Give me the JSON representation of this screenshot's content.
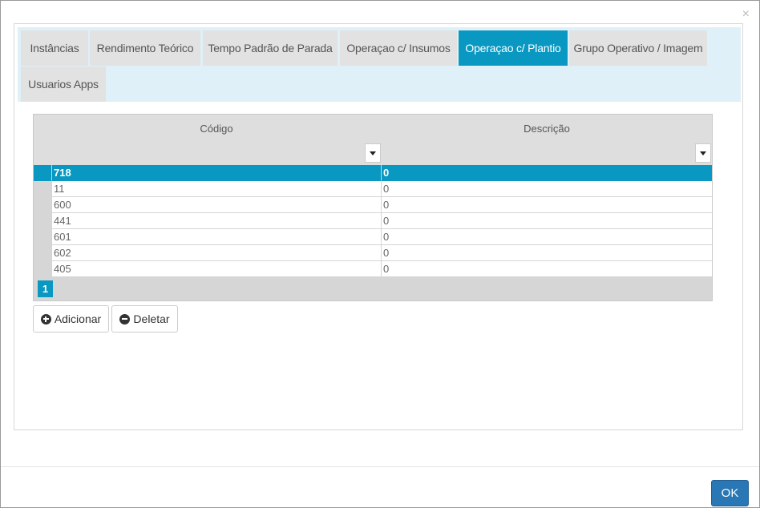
{
  "dialog": {
    "close_glyph": "×"
  },
  "tabs": [
    {
      "label": "Instâncias",
      "active": false
    },
    {
      "label": "Rendimento Teórico",
      "active": false
    },
    {
      "label": "Tempo Padrão de Parada",
      "active": false
    },
    {
      "label": "Operaçao c/ Insumos",
      "active": false
    },
    {
      "label": "Operaçao c/ Plantio",
      "active": true
    },
    {
      "label": "Grupo Operativo / Imagem",
      "active": false
    },
    {
      "label": "Usuarios Apps",
      "active": false
    }
  ],
  "grid": {
    "columns": [
      "Código",
      "Descrição"
    ],
    "rows": [
      {
        "codigo": "718",
        "descricao": "0",
        "selected": true
      },
      {
        "codigo": "11",
        "descricao": "0",
        "selected": false
      },
      {
        "codigo": "600",
        "descricao": "0",
        "selected": false
      },
      {
        "codigo": "441",
        "descricao": "0",
        "selected": false
      },
      {
        "codigo": "601",
        "descricao": "0",
        "selected": false
      },
      {
        "codigo": "602",
        "descricao": "0",
        "selected": false
      },
      {
        "codigo": "405",
        "descricao": "0",
        "selected": false
      }
    ],
    "pager": {
      "current_page": "1"
    }
  },
  "actions": {
    "add_label": "Adicionar",
    "delete_label": "Deletar"
  },
  "footer": {
    "ok_label": "OK"
  },
  "colors": {
    "accent": "#0898c2",
    "tab_bar": "#dff0f8",
    "ok_button": "#2a77b5"
  }
}
